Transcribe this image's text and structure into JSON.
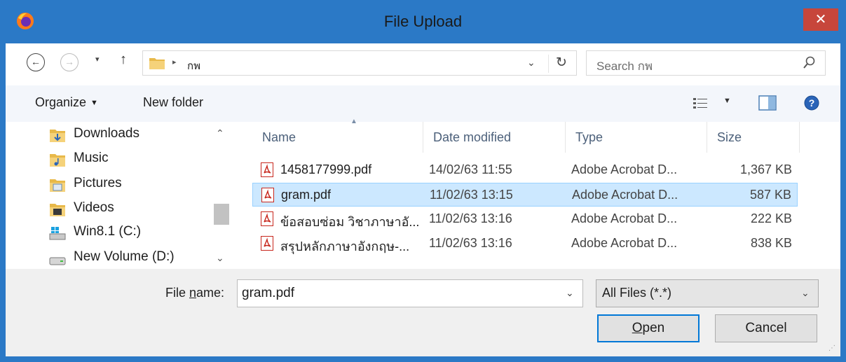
{
  "window": {
    "title": "File Upload",
    "close_glyph": "✕"
  },
  "address": {
    "back_glyph": "←",
    "forward_glyph": "→",
    "recent_glyph": "▾",
    "up_glyph": "↑",
    "crumb_sep": "▸",
    "crumb": "กพ",
    "drop_glyph": "⌄",
    "refresh_glyph": "↻",
    "search_placeholder": "Search กพ"
  },
  "toolbar": {
    "organize": "Organize",
    "organize_caret": "▼",
    "new_folder": "New folder",
    "view_caret": "▼"
  },
  "nav": {
    "items": [
      {
        "label": "Downloads",
        "icon": "downloads-folder-icon"
      },
      {
        "label": "Music",
        "icon": "music-folder-icon"
      },
      {
        "label": "Pictures",
        "icon": "pictures-folder-icon"
      },
      {
        "label": "Videos",
        "icon": "videos-folder-icon"
      },
      {
        "label": "Win8.1 (C:)",
        "icon": "system-drive-icon"
      },
      {
        "label": "New Volume (D:)",
        "icon": "drive-icon"
      }
    ],
    "scroll_up": "⌃",
    "scroll_down": "⌄"
  },
  "columns": {
    "name": "Name",
    "date": "Date modified",
    "type": "Type",
    "size": "Size",
    "sort_glyph": "▲"
  },
  "files": [
    {
      "name": "1458177999.pdf",
      "date": "14/02/63 11:55",
      "type": "Adobe Acrobat D...",
      "size": "1,367 KB",
      "selected": false
    },
    {
      "name": "gram.pdf",
      "date": "11/02/63 13:15",
      "type": "Adobe Acrobat D...",
      "size": "587 KB",
      "selected": true
    },
    {
      "name": "ข้อสอบซ่อม วิชาภาษาอั...",
      "date": "11/02/63 13:16",
      "type": "Adobe Acrobat D...",
      "size": "222 KB",
      "selected": false
    },
    {
      "name": "สรุปหลักภาษาอังกฤษ-...",
      "date": "11/02/63 13:16",
      "type": "Adobe Acrobat D...",
      "size": "838 KB",
      "selected": false
    }
  ],
  "bottom": {
    "file_name_label_pre": "File ",
    "file_name_label_u": "n",
    "file_name_label_post": "ame:",
    "file_name_value": "gram.pdf",
    "filter_value": "All Files (*.*)",
    "drop_glyph": "⌄",
    "open_u": "O",
    "open_rest": "pen",
    "cancel": "Cancel",
    "grip": "⋰"
  },
  "colors": {
    "titlebar": "#2b79c6",
    "close": "#c7463b",
    "selection": "#cce8ff",
    "accent": "#0078d7"
  }
}
